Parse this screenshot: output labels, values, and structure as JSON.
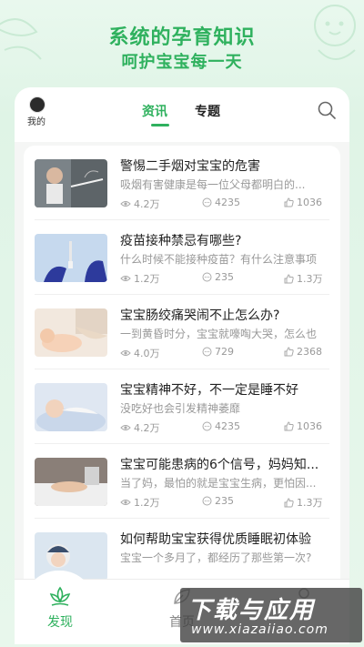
{
  "hero": {
    "title": "系统的孕育知识",
    "subtitle": "呵护宝宝每一天"
  },
  "header": {
    "avatar_label": "我的",
    "tabs": [
      {
        "label": "资讯",
        "active": true
      },
      {
        "label": "专题",
        "active": false
      }
    ]
  },
  "articles": [
    {
      "title": "警惕二手烟对宝宝的危害",
      "summary": "吸烟有害健康是每一位父母都明白的...",
      "views": "4.2万",
      "comments": "4235",
      "likes": "1036"
    },
    {
      "title": "疫苗接种禁忌有哪些?",
      "summary": "什么时候不能接种疫苗？有什么注意事项",
      "views": "1.2万",
      "comments": "235",
      "likes": "1.3万"
    },
    {
      "title": "宝宝肠绞痛哭闹不止怎么办?",
      "summary": "一到黄昏时分，宝宝就嚎啕大哭，怎么也",
      "views": "4.0万",
      "comments": "729",
      "likes": "2368"
    },
    {
      "title": "宝宝精神不好，不一定是睡不好",
      "summary": "没吃好也会引发精神萎靡",
      "views": "4.2万",
      "comments": "4235",
      "likes": "1036"
    },
    {
      "title": "宝宝可能患病的6个信号，妈妈知...",
      "summary": "当了妈，最怕的就是宝宝生病，更怕因...",
      "views": "1.2万",
      "comments": "235",
      "likes": "1.3万"
    },
    {
      "title": "如何帮助宝宝获得优质睡眠初体验",
      "summary": "宝宝一个多月了，都经历了那些第一次?",
      "views": "",
      "comments": "",
      "likes": ""
    }
  ],
  "bottom_nav": [
    {
      "label": "发现",
      "active": true
    },
    {
      "label": "首页",
      "active": false
    },
    {
      "label": "",
      "active": false
    }
  ],
  "watermark": {
    "main": "下载与应用",
    "url": "www.xiazaiiao.com"
  },
  "colors": {
    "accent": "#2fb15e",
    "background": "#e6f6eb",
    "text_primary": "#222222",
    "text_secondary": "#999999"
  }
}
